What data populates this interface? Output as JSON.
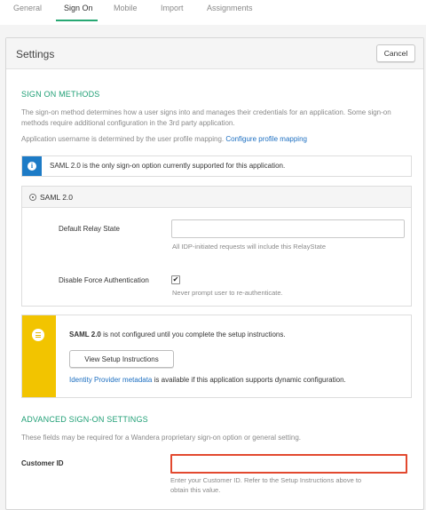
{
  "tabs": [
    {
      "label": "General"
    },
    {
      "label": "Sign On"
    },
    {
      "label": "Mobile"
    },
    {
      "label": "Import"
    },
    {
      "label": "Assignments"
    }
  ],
  "active_tab": "Sign On",
  "panel": {
    "title": "Settings",
    "cancel_label": "Cancel"
  },
  "sign_on": {
    "heading": "SIGN ON METHODS",
    "description": "The sign-on method determines how a user signs into and manages their credentials for an application. Some sign-on methods require additional configuration in the 3rd party application.",
    "username_text": "Application username is determined by the user profile mapping.",
    "username_link": "Configure profile mapping",
    "info_text": "SAML 2.0 is the only sign-on option currently supported for this application.",
    "method_label": "SAML 2.0",
    "relay_label": "Default Relay State",
    "relay_value": "",
    "relay_hint": "All IDP-initiated requests will include this RelayState",
    "force_auth_label": "Disable Force Authentication",
    "force_auth_checked": true,
    "force_auth_hint": "Never prompt user to re-authenticate."
  },
  "warning": {
    "text_bold": "SAML 2.0",
    "text_rest": "is not configured until you complete the setup instructions.",
    "button_label": "View Setup Instructions",
    "metadata_link": "Identity Provider metadata",
    "metadata_rest": "is available if this application supports dynamic configuration."
  },
  "advanced": {
    "heading": "ADVANCED SIGN-ON SETTINGS",
    "description": "These fields may be required for a Wandera proprietary sign-on option or general setting.",
    "customer_label": "Customer ID",
    "customer_value": "",
    "customer_hint_1": "Enter your Customer ID. Refer to the Setup Instructions above to",
    "customer_hint_2": "obtain this value."
  },
  "colors": {
    "accent_green": "#27a873",
    "info_blue": "#1d7bc6",
    "warning_yellow": "#f2c400",
    "error_red": "#e2492f",
    "link_blue": "#1d6fc1"
  }
}
